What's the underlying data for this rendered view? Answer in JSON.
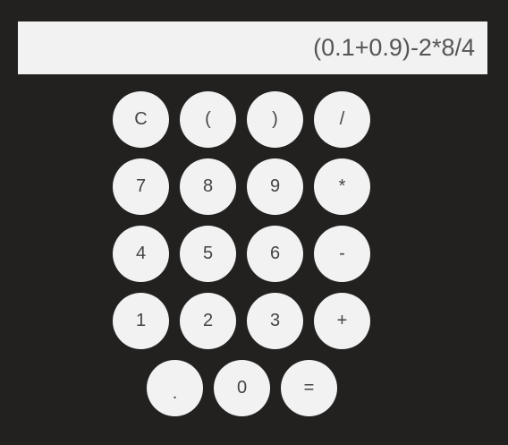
{
  "display": {
    "expression": "(0.1+0.9)-2*8/4"
  },
  "keys": {
    "clear": "C",
    "open_paren": "(",
    "close_paren": ")",
    "divide": "/",
    "seven": "7",
    "eight": "8",
    "nine": "9",
    "multiply": "*",
    "four": "4",
    "five": "5",
    "six": "6",
    "minus": "-",
    "one": "1",
    "two": "2",
    "three": "3",
    "plus": "+",
    "decimal": ".",
    "zero": "0",
    "equals": "="
  },
  "colors": {
    "background": "#222120",
    "display_bg": "#f2f2f2",
    "key_bg": "#f2f2f2",
    "text": "#444444"
  }
}
